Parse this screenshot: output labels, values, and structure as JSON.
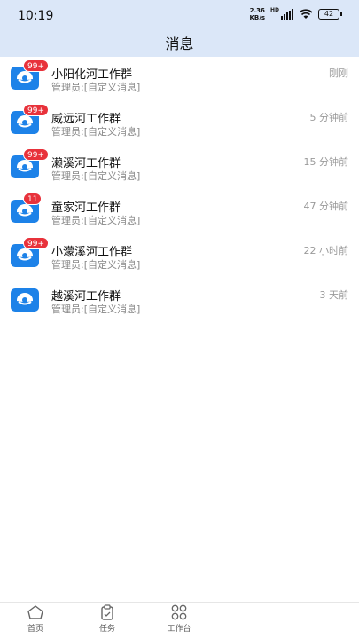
{
  "status_bar": {
    "time": "10:19",
    "net_speed_value": "2.36",
    "net_speed_unit": "KB/s",
    "network_type": "HD",
    "battery": "42"
  },
  "header": {
    "title": "消息"
  },
  "conversations": [
    {
      "name": "小阳化河工作群",
      "preview": "管理员:[自定义消息]",
      "time": "刚刚",
      "badge": "99+"
    },
    {
      "name": "威远河工作群",
      "preview": "管理员:[自定义消息]",
      "time": "5 分钟前",
      "badge": "99+"
    },
    {
      "name": "濑溪河工作群",
      "preview": "管理员:[自定义消息]",
      "time": "15 分钟前",
      "badge": "99+"
    },
    {
      "name": "童家河工作群",
      "preview": "管理员:[自定义消息]",
      "time": "47 分钟前",
      "badge": "11"
    },
    {
      "name": "小濛溪河工作群",
      "preview": "管理员:[自定义消息]",
      "time": "22 小时前",
      "badge": "99+"
    },
    {
      "name": "越溪河工作群",
      "preview": "管理员:[自定义消息]",
      "time": "3 天前",
      "badge": ""
    }
  ],
  "tab_bar": {
    "home_label": "首页",
    "tasks_label": "任务",
    "workbench_label": "工作台"
  },
  "colors": {
    "header_bg": "#dbe7f8",
    "avatar_blue": "#1d82e8",
    "badge_red": "#e8323b"
  },
  "icons": {
    "avatar": "group-chat-icon",
    "home": "home-icon",
    "tasks": "clipboard-icon",
    "workbench": "grid-icon"
  }
}
